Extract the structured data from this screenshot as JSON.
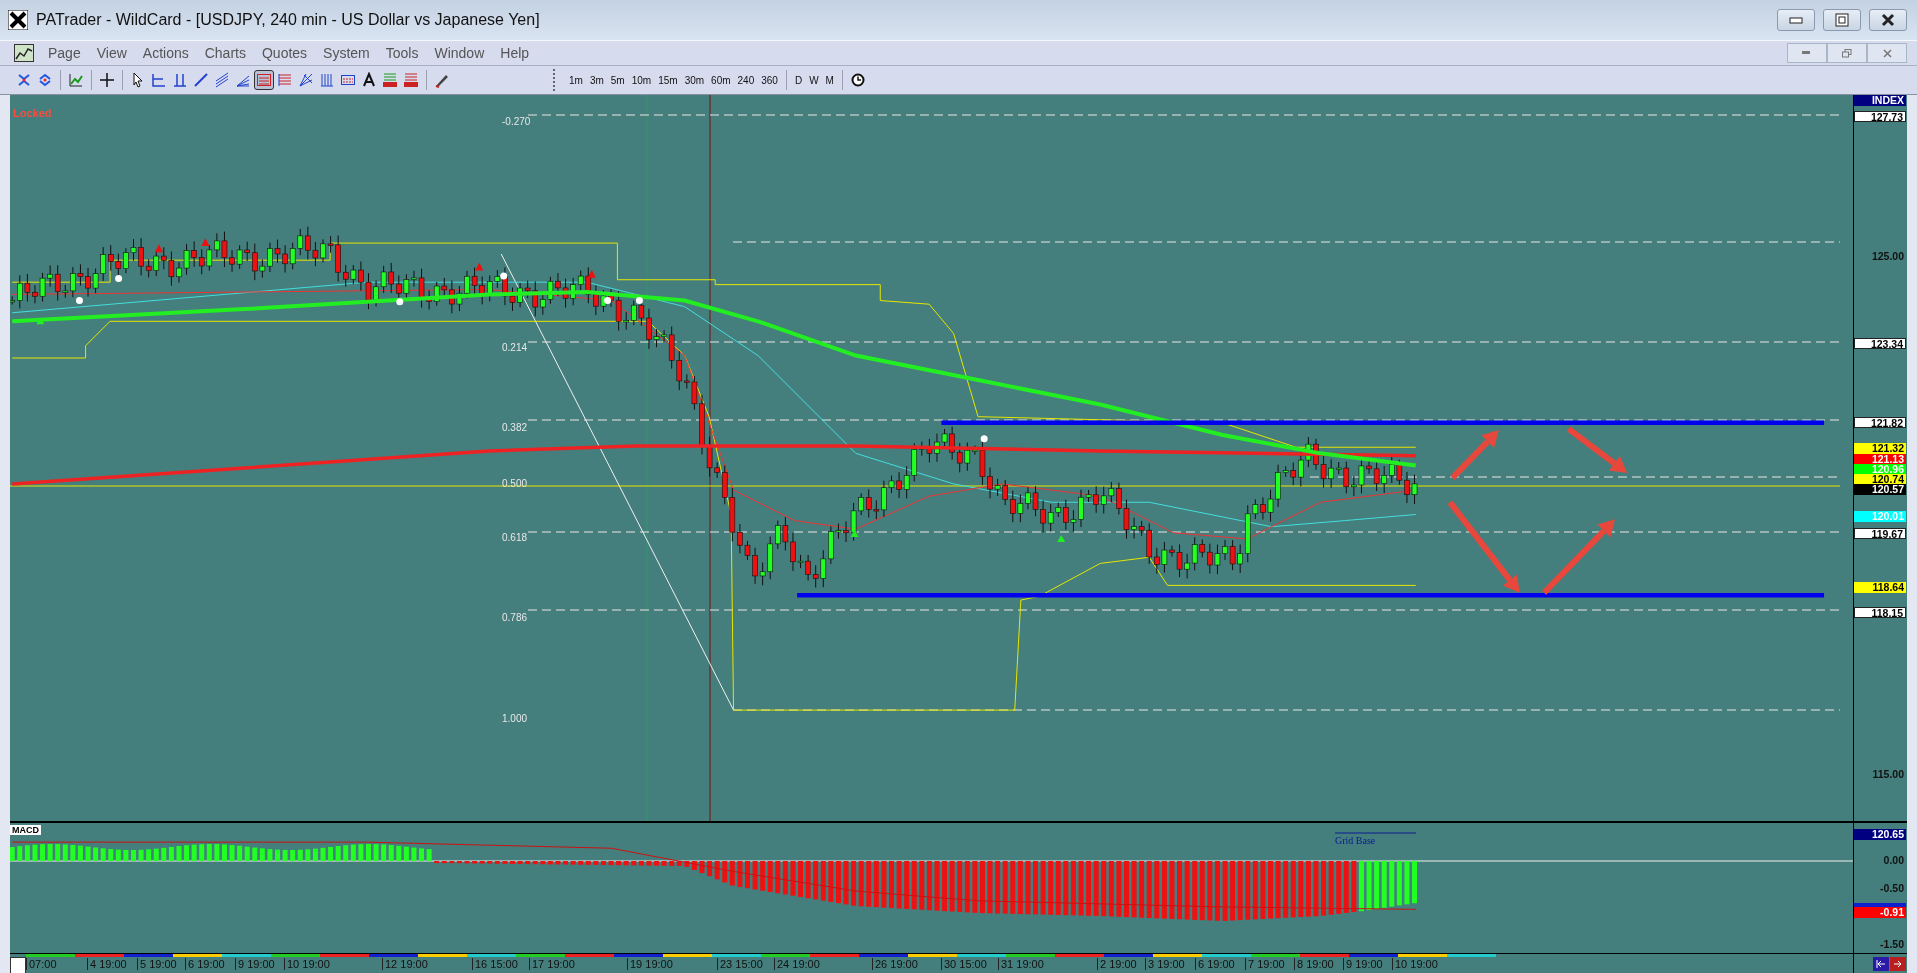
{
  "window": {
    "title": "PATrader - WildCard - [USDJPY, 240 min - US Dollar vs Japanese Yen]"
  },
  "menu": [
    "Page",
    "View",
    "Actions",
    "Charts",
    "Quotes",
    "System",
    "Tools",
    "Window",
    "Help"
  ],
  "toolbar": {
    "tools": [
      {
        "selected": false
      },
      {
        "selected": false
      },
      {
        "selected": false
      },
      {
        "selected": false
      },
      {
        "selected": false
      },
      {
        "selected": false
      },
      {
        "selected": false
      },
      {
        "selected": false
      },
      {
        "selected": false
      },
      {
        "selected": false
      },
      {
        "selected": true
      },
      {
        "selected": false
      },
      {
        "selected": false
      },
      {
        "selected": false
      },
      {
        "selected": false
      },
      {
        "selected": false
      },
      {
        "selected": false
      },
      {
        "selected": false
      },
      {
        "selected": false
      }
    ],
    "timeframes": [
      "1m",
      "3m",
      "5m",
      "10m",
      "15m",
      "30m",
      "60m",
      "240",
      "360"
    ],
    "periods": [
      "D",
      "W",
      "M"
    ]
  },
  "chart": {
    "status": "Locked",
    "fib_levels": [
      "-0.270",
      "0.214",
      "0.382",
      "0.500",
      "0.618",
      "0.786",
      "1.000"
    ],
    "price_labels": [
      {
        "text": "INDEX",
        "kind": "tag",
        "color": "#000080"
      },
      {
        "text": "127.73",
        "kind": "tag",
        "color": "#ffffff"
      },
      {
        "text": "125.00",
        "kind": "tick"
      },
      {
        "text": "123.34",
        "kind": "tag",
        "color": "#ffffff"
      },
      {
        "text": "121.82",
        "kind": "tag",
        "color": "#ffffff"
      },
      {
        "text": "121.32",
        "kind": "tag",
        "color": "#ffff00"
      },
      {
        "text": "121.13",
        "kind": "tag",
        "color": "#ff0000"
      },
      {
        "text": "120.96",
        "kind": "tag",
        "color": "#00ff00"
      },
      {
        "text": "120.74",
        "kind": "tag",
        "color": "#ffff00"
      },
      {
        "text": "120.57",
        "kind": "tag",
        "color": "#000000"
      },
      {
        "text": "120.01",
        "kind": "tag",
        "color": "#00ffff"
      },
      {
        "text": "119.67",
        "kind": "tag",
        "color": "#ffffff"
      },
      {
        "text": "118.64",
        "kind": "tag",
        "color": "#ffff00"
      },
      {
        "text": "118.15",
        "kind": "tag",
        "color": "#ffffff"
      },
      {
        "text": "115.00",
        "kind": "tick"
      }
    ]
  },
  "macd": {
    "title": "MACD",
    "grid_base": "Grid Base",
    "labels": [
      {
        "text": "120.65",
        "kind": "tag",
        "color": "#000080"
      },
      {
        "text": "0.00",
        "kind": "tick"
      },
      {
        "text": "-0.50",
        "kind": "tick"
      },
      {
        "text": "-0.91",
        "kind": "tag",
        "color": "#ff0000"
      },
      {
        "text": "-1.50",
        "kind": "tick"
      }
    ]
  },
  "time_axis": [
    "07:00",
    "4 19:00",
    "5 19:00",
    "6 19:00",
    "9 19:00",
    "10 19:00",
    "12 19:00",
    "16 15:00",
    "17 19:00",
    "19 19:00",
    "23 15:00",
    "24 19:00",
    "26 19:00",
    "30 15:00",
    "31 19:00",
    "2 19:00",
    "3 19:00",
    "6 19:00",
    "7 19:00",
    "8 19:00",
    "9 19:00",
    "10 19:00"
  ]
}
